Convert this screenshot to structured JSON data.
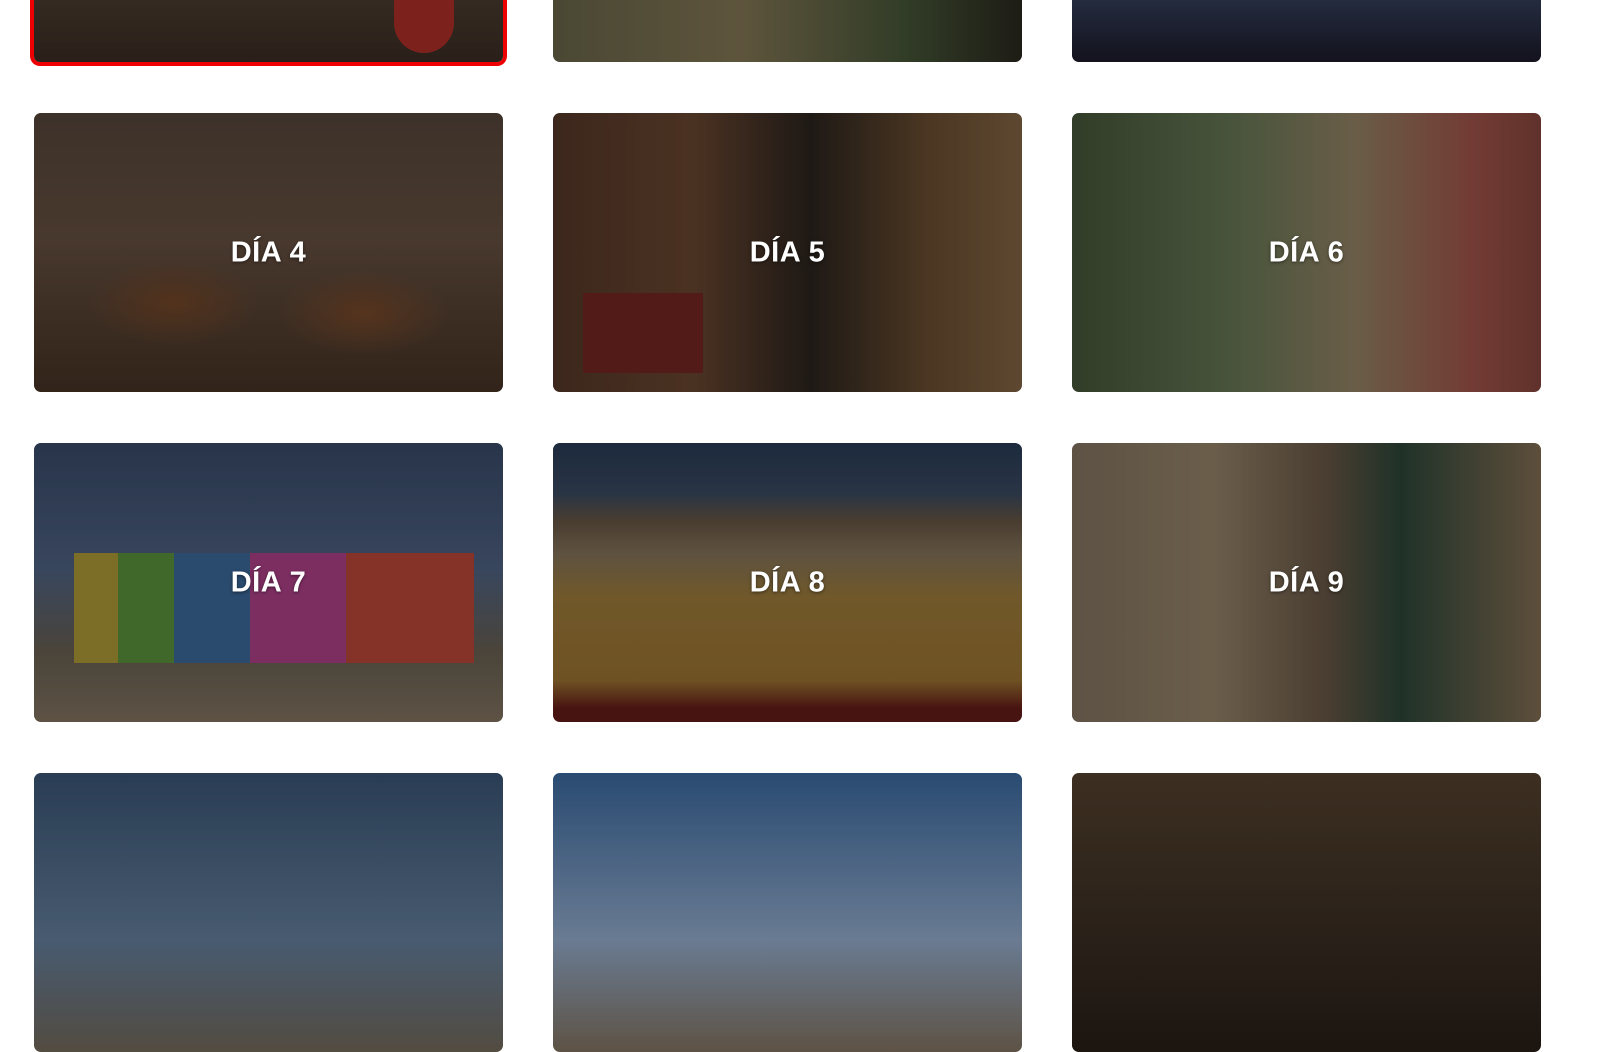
{
  "accent": "#ee0000",
  "cards": [
    {
      "label": "",
      "selected": true
    },
    {
      "label": ""
    },
    {
      "label": ""
    },
    {
      "label": "DÍA 4"
    },
    {
      "label": "DÍA 5"
    },
    {
      "label": "DÍA 6"
    },
    {
      "label": "DÍA 7"
    },
    {
      "label": "DÍA 8"
    },
    {
      "label": "DÍA 9"
    },
    {
      "label": ""
    },
    {
      "label": ""
    },
    {
      "label": ""
    }
  ]
}
